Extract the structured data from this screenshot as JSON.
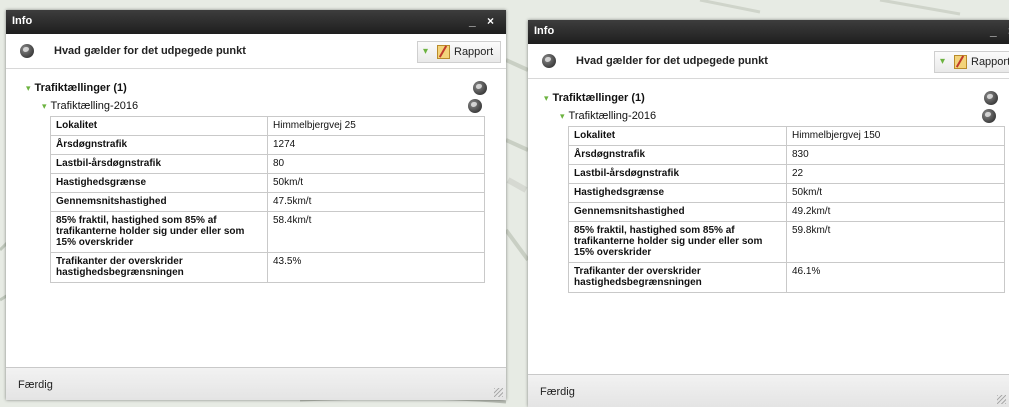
{
  "panels": [
    {
      "window_title": "Info",
      "window_controls": "_ ×",
      "header_title": "Hvad gælder for det udpegede punkt",
      "report_label": "Rapport",
      "group_label": "Trafiktællinger (1)",
      "subgroup_label": "Trafiktælling-2016",
      "status": "Færdig",
      "rows": [
        {
          "key": "Lokalitet",
          "value": "Himmelbjergvej 25"
        },
        {
          "key": "Årsdøgnstrafik",
          "value": "1274"
        },
        {
          "key": "Lastbil-årsdøgnstrafik",
          "value": "80"
        },
        {
          "key": "Hastighedsgrænse",
          "value": "50km/t"
        },
        {
          "key": "Gennemsnitshastighed",
          "value": "47.5km/t"
        },
        {
          "key": "85% fraktil, hastighed som 85% af trafikanterne holder sig under eller som 15% overskrider",
          "value": "58.4km/t"
        },
        {
          "key": "Trafikanter der overskrider hastighedsbegrænsningen",
          "value": "43.5%"
        }
      ]
    },
    {
      "window_title": "Info",
      "window_controls": "_ ×",
      "header_title": "Hvad gælder for det udpegede punkt",
      "report_label": "Rapport",
      "group_label": "Trafiktællinger (1)",
      "subgroup_label": "Trafiktælling-2016",
      "status": "Færdig",
      "rows": [
        {
          "key": "Lokalitet",
          "value": "Himmelbjergvej 150"
        },
        {
          "key": "Årsdøgnstrafik",
          "value": "830"
        },
        {
          "key": "Lastbil-årsdøgnstrafik",
          "value": "22"
        },
        {
          "key": "Hastighedsgrænse",
          "value": "50km/t"
        },
        {
          "key": "Gennemsnitshastighed",
          "value": "49.2km/t"
        },
        {
          "key": "85% fraktil, hastighed som 85% af trafikanterne holder sig under eller som 15% overskrider",
          "value": "59.8km/t"
        },
        {
          "key": "Trafikanter der overskrider hastighedsbegrænsningen",
          "value": "46.1%"
        }
      ]
    }
  ],
  "icons": {
    "globe": "globe-icon",
    "expand": "expand-arrow-icon",
    "report": "report-pencil-icon",
    "resize": "resize-grip-icon"
  },
  "colors": {
    "titlebar": "#2a2a2a",
    "expand_arrow": "#6cb33f",
    "map_background": "#e7ebe4"
  }
}
